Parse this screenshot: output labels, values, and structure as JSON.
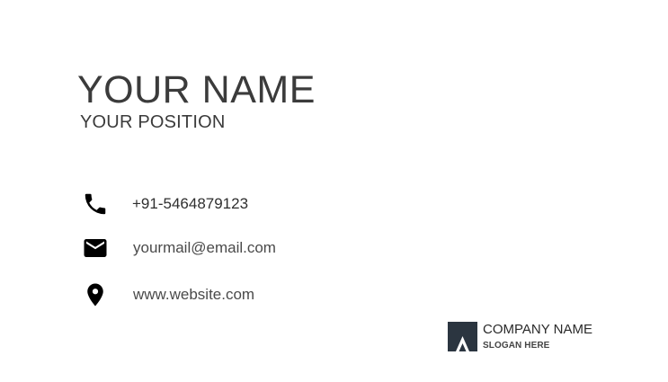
{
  "card": {
    "name": "YOUR NAME",
    "position": "YOUR POSITION"
  },
  "contacts": [
    {
      "icon": "phone-icon",
      "text": "+91-5464879123"
    },
    {
      "icon": "email-icon",
      "text": "yourmail@email.com"
    },
    {
      "icon": "location-pin-icon",
      "text": "www.website.com"
    }
  ],
  "company": {
    "logo_icon": "company-logo-icon",
    "name": "COMPANY NAME",
    "slogan": "SLOGAN HERE",
    "logo_color": "#2b3540"
  }
}
